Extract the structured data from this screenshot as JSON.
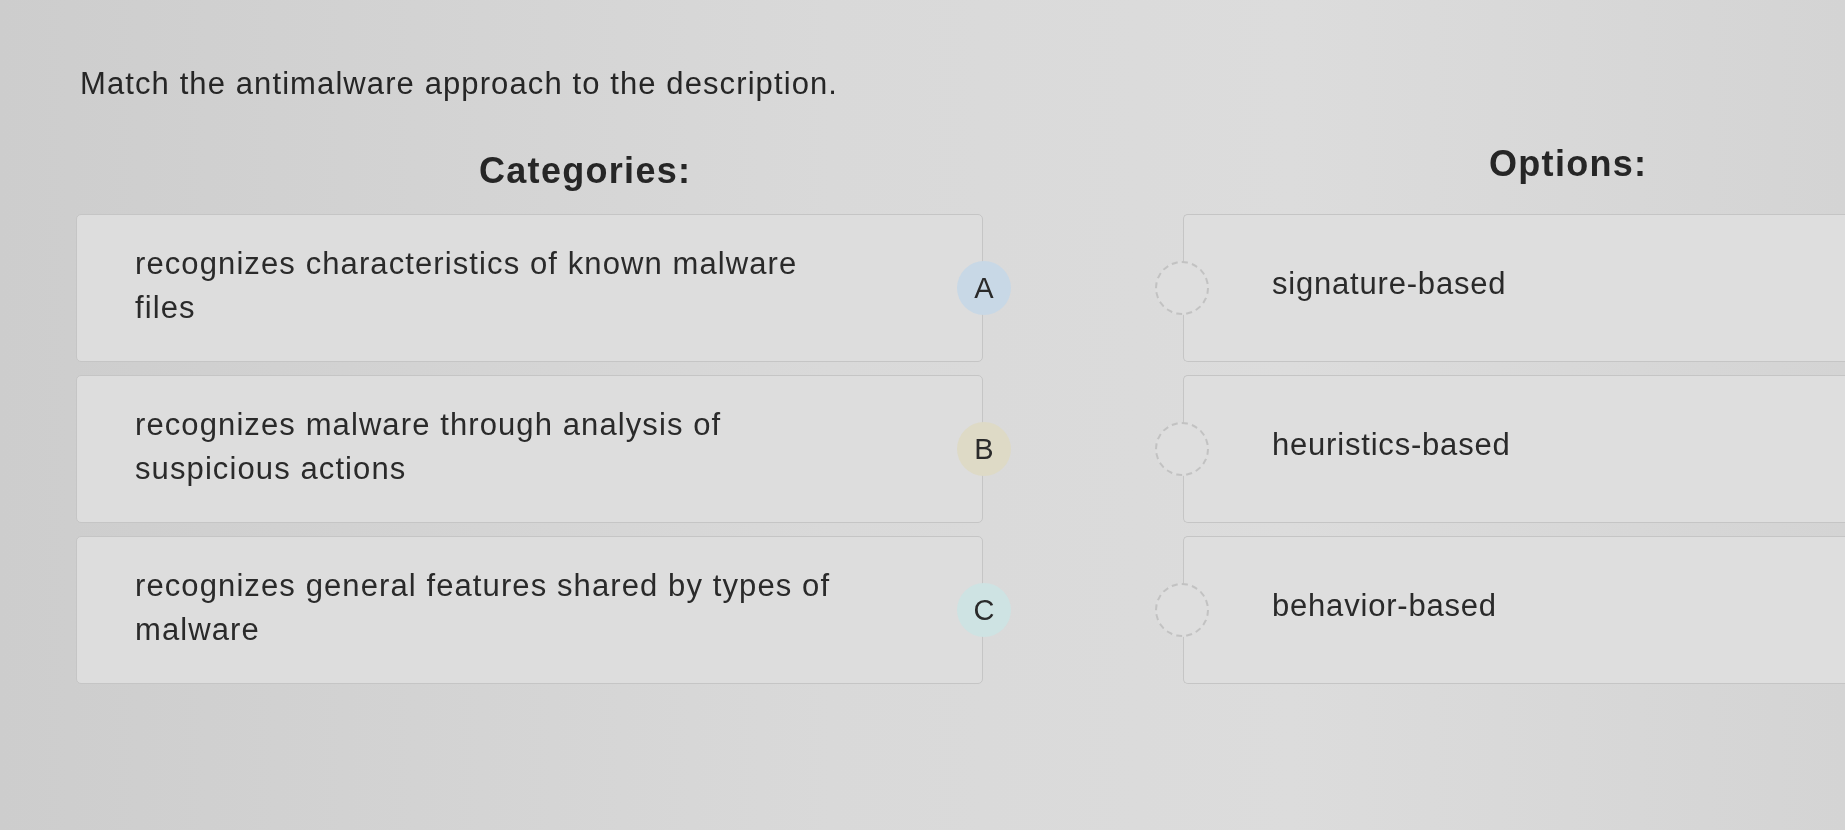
{
  "prompt": "Match the antimalware approach to the description.",
  "categories": {
    "heading": "Categories:",
    "items": [
      {
        "text": "recognizes characteristics of known malware files",
        "badge": "A",
        "color": "#c8d8e6"
      },
      {
        "text": "recognizes malware through analysis of suspicious actions",
        "badge": "B",
        "color": "#dedac6"
      },
      {
        "text": "recognizes general features shared by types of malware",
        "badge": "C",
        "color": "#cee3e3"
      }
    ]
  },
  "options": {
    "heading": "Options:",
    "items": [
      {
        "text": "signature-based"
      },
      {
        "text": "heuristics-based"
      },
      {
        "text": "behavior-based"
      }
    ]
  }
}
